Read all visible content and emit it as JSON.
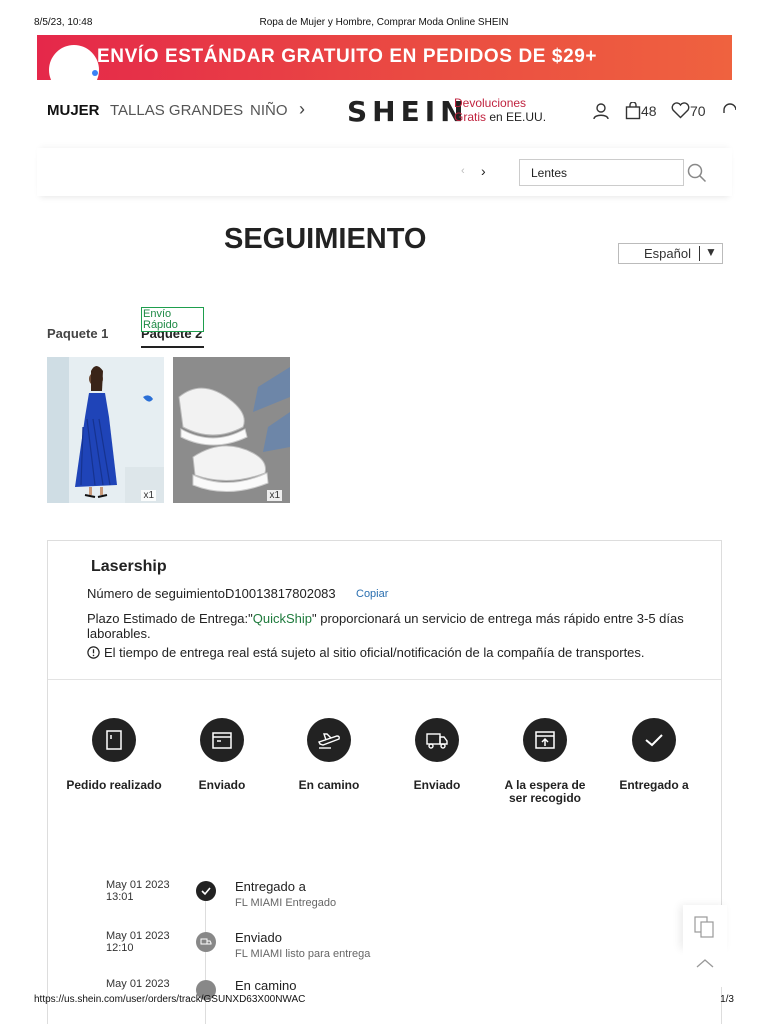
{
  "print_header": {
    "datetime": "8/5/23, 10:48",
    "title": "Ropa de Mujer y Hombre, Comprar Moda Online SHEIN"
  },
  "promo": {
    "text": "ENVÍO ESTÁNDAR GRATUITO EN PEDIDOS DE $29+",
    "colors": [
      "#e5284a",
      "#ef623f"
    ]
  },
  "nav": {
    "categories": [
      "MUJER",
      "TALLAS GRANDES",
      "NIÑO"
    ],
    "logo": "SHEIN",
    "returns_line1": "Devoluciones",
    "returns_line2_red": "Gratis",
    "returns_line2_dark": " en EE.UU.",
    "cart_count": "48",
    "wishlist_count": "70",
    "icons": [
      "user-icon",
      "bag-icon",
      "heart-icon",
      "headset-icon",
      "chevron-right-icon"
    ]
  },
  "search": {
    "value": "Lentes"
  },
  "page": {
    "title": "SEGUIMIENTO",
    "language": "Español"
  },
  "packages": {
    "tabs": [
      "Paquete 1",
      "Paquete 2"
    ],
    "active": "Paquete 2",
    "badge": "Envío Rápido",
    "items": [
      {
        "name": "blue-pleated-halter-dress",
        "qty": "x1"
      },
      {
        "name": "white-platform-sneakers",
        "qty": "x1"
      }
    ]
  },
  "tracking": {
    "carrier": "Lasership",
    "number_label": "Número de seguimiento",
    "number": "D10013817802083",
    "copy": "Copiar",
    "estimate_prefix": "Plazo Estimado de Entrega:\"",
    "estimate_quickship": "QuickShip",
    "estimate_suffix": "\" proporcionará un servicio de entrega más rápido entre 3-5 días laborables.",
    "notice": "El tiempo de entrega real está sujeto al sitio oficial/notificación de la compañía de transportes.",
    "steps": [
      {
        "label": "Pedido realizado",
        "icon": "document-icon"
      },
      {
        "label": "Enviado",
        "icon": "box-icon"
      },
      {
        "label": "En camino",
        "icon": "plane-icon"
      },
      {
        "label": "Enviado",
        "icon": "truck-icon"
      },
      {
        "label": "A la espera de ser recogido",
        "icon": "pickup-box-icon"
      },
      {
        "label": "Entregado a",
        "icon": "check-icon"
      }
    ],
    "timeline": [
      {
        "date": "May 01 2023",
        "time": "13:01",
        "status": "Entregado a",
        "detail": "FL MIAMI Entregado"
      },
      {
        "date": "May 01 2023",
        "time": "12:10",
        "status": "Enviado",
        "detail": "FL MIAMI listo para entrega"
      },
      {
        "date": "May 01 2023",
        "time": "",
        "status": "En camino",
        "detail": ""
      }
    ]
  },
  "print_footer": {
    "url": "https://us.shein.com/user/orders/track/GSUNXD63X00NWAC",
    "pages": "1/3"
  }
}
